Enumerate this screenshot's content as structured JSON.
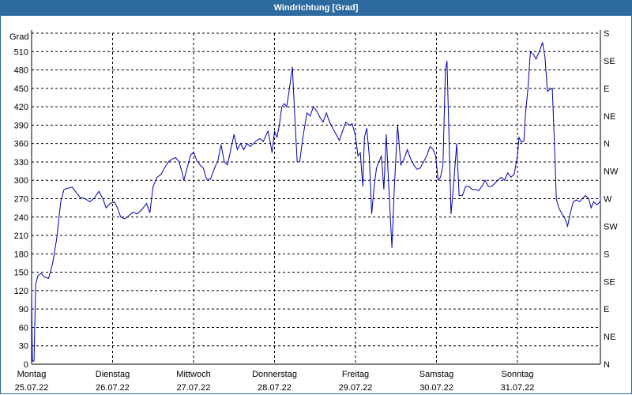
{
  "title": "Windrichtung [Grad]",
  "chart_data": {
    "type": "line",
    "title": "Windrichtung [Grad]",
    "ylabel": "Grad",
    "ylim": [
      0,
      540
    ],
    "y_ticks": [
      0,
      30,
      60,
      90,
      120,
      150,
      180,
      210,
      240,
      270,
      300,
      330,
      360,
      390,
      420,
      450,
      480,
      510
    ],
    "right_ticks": [
      {
        "value": 0,
        "label": "N"
      },
      {
        "value": 45,
        "label": "NE"
      },
      {
        "value": 90,
        "label": "E"
      },
      {
        "value": 135,
        "label": "SE"
      },
      {
        "value": 180,
        "label": "S"
      },
      {
        "value": 225,
        "label": "SW"
      },
      {
        "value": 270,
        "label": "W"
      },
      {
        "value": 315,
        "label": "NW"
      },
      {
        "value": 360,
        "label": "N"
      },
      {
        "value": 405,
        "label": "NE"
      },
      {
        "value": 450,
        "label": "E"
      },
      {
        "value": 495,
        "label": "SE"
      },
      {
        "value": 540,
        "label": "S"
      }
    ],
    "x_range": [
      0,
      7.0
    ],
    "day_ticks": [
      {
        "x": 0,
        "day": "Montag",
        "date": "25.07.22"
      },
      {
        "x": 1,
        "day": "Dienstag",
        "date": "26.07.22"
      },
      {
        "x": 2,
        "day": "Mittwoch",
        "date": "27.07.22"
      },
      {
        "x": 3,
        "day": "Donnerstag",
        "date": "28.07.22"
      },
      {
        "x": 4,
        "day": "Freitag",
        "date": "29.07.22"
      },
      {
        "x": 5,
        "day": "Samstag",
        "date": "30.07.22"
      },
      {
        "x": 6,
        "day": "Sonntag",
        "date": "31.07.22"
      }
    ],
    "grid": true,
    "series": [
      {
        "color": "#0000aa",
        "points": [
          [
            0.0,
            120
          ],
          [
            0.01,
            5
          ],
          [
            0.03,
            5
          ],
          [
            0.05,
            130
          ],
          [
            0.08,
            145
          ],
          [
            0.12,
            148
          ],
          [
            0.16,
            142
          ],
          [
            0.21,
            140
          ],
          [
            0.26,
            165
          ],
          [
            0.31,
            205
          ],
          [
            0.36,
            265
          ],
          [
            0.4,
            285
          ],
          [
            0.45,
            287
          ],
          [
            0.5,
            289
          ],
          [
            0.55,
            280
          ],
          [
            0.6,
            272
          ],
          [
            0.66,
            270
          ],
          [
            0.72,
            265
          ],
          [
            0.78,
            272
          ],
          [
            0.83,
            282
          ],
          [
            0.88,
            270
          ],
          [
            0.92,
            255
          ],
          [
            0.97,
            262
          ],
          [
            1.02,
            265
          ],
          [
            1.06,
            255
          ],
          [
            1.1,
            240
          ],
          [
            1.15,
            237
          ],
          [
            1.2,
            242
          ],
          [
            1.25,
            248
          ],
          [
            1.3,
            245
          ],
          [
            1.36,
            252
          ],
          [
            1.42,
            262
          ],
          [
            1.46,
            247
          ],
          [
            1.5,
            290
          ],
          [
            1.55,
            305
          ],
          [
            1.6,
            310
          ],
          [
            1.64,
            320
          ],
          [
            1.69,
            330
          ],
          [
            1.74,
            335
          ],
          [
            1.78,
            337
          ],
          [
            1.82,
            330
          ],
          [
            1.86,
            312
          ],
          [
            1.88,
            300
          ],
          [
            1.92,
            320
          ],
          [
            1.96,
            340
          ],
          [
            2.0,
            346
          ],
          [
            2.04,
            332
          ],
          [
            2.08,
            325
          ],
          [
            2.12,
            320
          ],
          [
            2.16,
            302
          ],
          [
            2.21,
            302
          ],
          [
            2.26,
            320
          ],
          [
            2.3,
            332
          ],
          [
            2.34,
            358
          ],
          [
            2.38,
            330
          ],
          [
            2.42,
            325
          ],
          [
            2.46,
            350
          ],
          [
            2.5,
            375
          ],
          [
            2.54,
            350
          ],
          [
            2.58,
            360
          ],
          [
            2.62,
            350
          ],
          [
            2.66,
            360
          ],
          [
            2.7,
            355
          ],
          [
            2.74,
            360
          ],
          [
            2.78,
            365
          ],
          [
            2.82,
            368
          ],
          [
            2.86,
            363
          ],
          [
            2.89,
            372
          ],
          [
            2.92,
            380
          ],
          [
            2.95,
            360
          ],
          [
            2.97,
            345
          ],
          [
            3.0,
            380
          ],
          [
            3.03,
            370
          ],
          [
            3.06,
            390
          ],
          [
            3.09,
            420
          ],
          [
            3.12,
            425
          ],
          [
            3.15,
            420
          ],
          [
            3.18,
            445
          ],
          [
            3.22,
            485
          ],
          [
            3.25,
            405
          ],
          [
            3.28,
            330
          ],
          [
            3.31,
            330
          ],
          [
            3.35,
            370
          ],
          [
            3.4,
            410
          ],
          [
            3.44,
            405
          ],
          [
            3.48,
            420
          ],
          [
            3.52,
            413
          ],
          [
            3.56,
            403
          ],
          [
            3.6,
            395
          ],
          [
            3.64,
            410
          ],
          [
            3.68,
            395
          ],
          [
            3.72,
            385
          ],
          [
            3.76,
            375
          ],
          [
            3.8,
            365
          ],
          [
            3.84,
            380
          ],
          [
            3.88,
            395
          ],
          [
            3.92,
            390
          ],
          [
            3.96,
            392
          ],
          [
            4.0,
            372
          ],
          [
            4.03,
            340
          ],
          [
            4.06,
            345
          ],
          [
            4.09,
            290
          ],
          [
            4.11,
            370
          ],
          [
            4.14,
            385
          ],
          [
            4.17,
            340
          ],
          [
            4.2,
            245
          ],
          [
            4.23,
            290
          ],
          [
            4.26,
            320
          ],
          [
            4.29,
            330
          ],
          [
            4.32,
            340
          ],
          [
            4.35,
            285
          ],
          [
            4.38,
            375
          ],
          [
            4.42,
            265
          ],
          [
            4.45,
            190
          ],
          [
            4.48,
            290
          ],
          [
            4.52,
            390
          ],
          [
            4.56,
            325
          ],
          [
            4.6,
            335
          ],
          [
            4.64,
            350
          ],
          [
            4.68,
            335
          ],
          [
            4.72,
            325
          ],
          [
            4.76,
            318
          ],
          [
            4.8,
            320
          ],
          [
            4.84,
            330
          ],
          [
            4.88,
            340
          ],
          [
            4.92,
            355
          ],
          [
            4.96,
            350
          ],
          [
            4.99,
            340
          ],
          [
            5.02,
            300
          ],
          [
            5.05,
            305
          ],
          [
            5.08,
            325
          ],
          [
            5.11,
            480
          ],
          [
            5.13,
            495
          ],
          [
            5.16,
            345
          ],
          [
            5.18,
            245
          ],
          [
            5.21,
            290
          ],
          [
            5.25,
            360
          ],
          [
            5.28,
            275
          ],
          [
            5.32,
            275
          ],
          [
            5.36,
            290
          ],
          [
            5.4,
            290
          ],
          [
            5.44,
            285
          ],
          [
            5.48,
            285
          ],
          [
            5.52,
            283
          ],
          [
            5.56,
            290
          ],
          [
            5.6,
            300
          ],
          [
            5.64,
            290
          ],
          [
            5.68,
            290
          ],
          [
            5.72,
            295
          ],
          [
            5.76,
            300
          ],
          [
            5.8,
            305
          ],
          [
            5.84,
            300
          ],
          [
            5.88,
            312
          ],
          [
            5.92,
            305
          ],
          [
            5.96,
            310
          ],
          [
            6.0,
            340
          ],
          [
            6.02,
            370
          ],
          [
            6.05,
            362
          ],
          [
            6.08,
            365
          ],
          [
            6.1,
            410
          ],
          [
            6.13,
            450
          ],
          [
            6.16,
            510
          ],
          [
            6.2,
            505
          ],
          [
            6.23,
            498
          ],
          [
            6.27,
            510
          ],
          [
            6.31,
            525
          ],
          [
            6.34,
            500
          ],
          [
            6.37,
            445
          ],
          [
            6.4,
            448
          ],
          [
            6.43,
            450
          ],
          [
            6.46,
            350
          ],
          [
            6.48,
            270
          ],
          [
            6.51,
            255
          ],
          [
            6.55,
            245
          ],
          [
            6.58,
            240
          ],
          [
            6.62,
            225
          ],
          [
            6.65,
            245
          ],
          [
            6.69,
            265
          ],
          [
            6.73,
            268
          ],
          [
            6.77,
            265
          ],
          [
            6.8,
            270
          ],
          [
            6.84,
            275
          ],
          [
            6.88,
            270
          ],
          [
            6.91,
            255
          ],
          [
            6.94,
            265
          ],
          [
            6.98,
            260
          ],
          [
            7.02,
            265
          ],
          [
            7.06,
            265
          ],
          [
            7.1,
            268
          ],
          [
            7.13,
            270
          ],
          [
            7.16,
            265
          ],
          [
            7.2,
            272
          ],
          [
            7.23,
            268
          ],
          [
            7.26,
            272
          ],
          [
            7.3,
            262
          ],
          [
            7.34,
            270
          ],
          [
            7.37,
            275
          ],
          [
            7.4,
            268
          ]
        ]
      }
    ]
  }
}
